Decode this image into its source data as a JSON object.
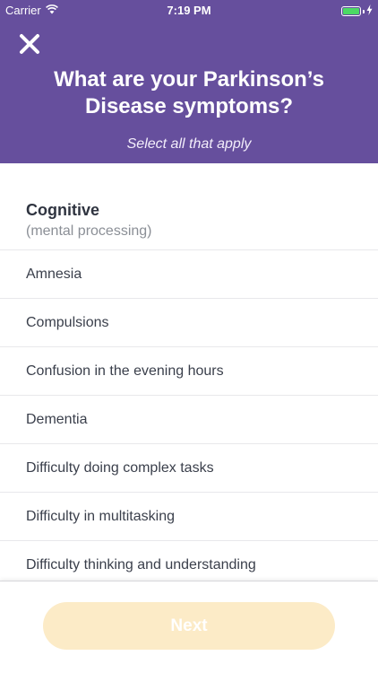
{
  "status_bar": {
    "carrier": "Carrier",
    "time": "7:19 PM",
    "wifi_icon": "wifi-icon",
    "battery_icon": "battery-icon",
    "charging_icon": "charging-bolt-icon"
  },
  "header": {
    "close_icon": "close-icon",
    "title": "What are your Parkinson’s Disease symptoms?",
    "subtitle": "Select all that apply",
    "background_color": "#664f9d"
  },
  "section": {
    "title": "Cognitive",
    "subtitle": "(mental processing)"
  },
  "symptoms": [
    {
      "label": "Amnesia"
    },
    {
      "label": "Compulsions"
    },
    {
      "label": "Confusion in the evening hours"
    },
    {
      "label": "Dementia"
    },
    {
      "label": "Difficulty doing complex tasks"
    },
    {
      "label": "Difficulty in multitasking"
    },
    {
      "label": "Difficulty thinking and understanding"
    }
  ],
  "footer": {
    "next_label": "Next",
    "next_disabled": true,
    "button_color": "#fcebc7"
  }
}
